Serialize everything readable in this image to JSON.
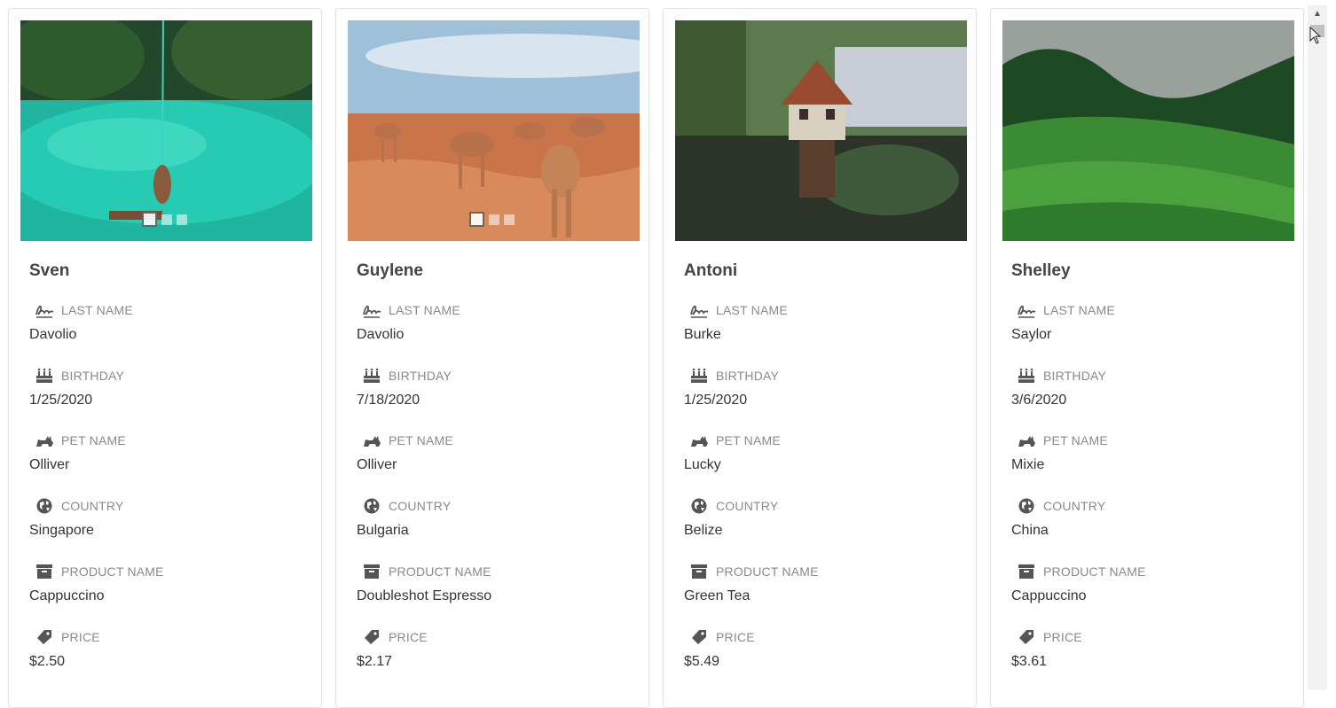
{
  "labels": {
    "last_name": "LAST NAME",
    "birthday": "BIRTHDAY",
    "pet_name": "PET NAME",
    "country": "COUNTRY",
    "product_name": "PRODUCT NAME",
    "price": "PRICE"
  },
  "icons": {
    "last_name": "signature-icon",
    "birthday": "birthday-cake-icon",
    "pet_name": "cat-icon",
    "country": "globe-icon",
    "product_name": "archive-box-icon",
    "price": "price-tag-icon"
  },
  "cards": [
    {
      "first_name": "Sven",
      "last_name": "Davolio",
      "birthday": "1/25/2020",
      "pet_name": "Olliver",
      "country": "Singapore",
      "product_name": "Cappuccino",
      "price": "$2.50",
      "image": "turquoise-pool-swing",
      "carousel_dots": 3,
      "carousel_active": 0
    },
    {
      "first_name": "Guylene",
      "last_name": "Davolio",
      "birthday": "7/18/2020",
      "pet_name": "Olliver",
      "country": "Bulgaria",
      "product_name": "Doubleshot Espresso",
      "price": "$2.17",
      "image": "desert-camels",
      "carousel_dots": 3,
      "carousel_active": 0
    },
    {
      "first_name": "Antoni",
      "last_name": "Burke",
      "birthday": "1/25/2020",
      "pet_name": "Lucky",
      "country": "Belize",
      "product_name": "Green Tea",
      "price": "$5.49",
      "image": "miniature-treehouse",
      "carousel_dots": 0,
      "carousel_active": null
    },
    {
      "first_name": "Shelley",
      "last_name": "Saylor",
      "birthday": "3/6/2020",
      "pet_name": "Mixie",
      "country": "China",
      "product_name": "Cappuccino",
      "price": "$3.61",
      "image": "tea-plantation-hills",
      "carousel_dots": 0,
      "carousel_active": null
    }
  ],
  "colors": {
    "card_border": "#e4e4e4",
    "label_text": "#8a8a8a",
    "value_text": "#333333",
    "icon": "#555555"
  }
}
